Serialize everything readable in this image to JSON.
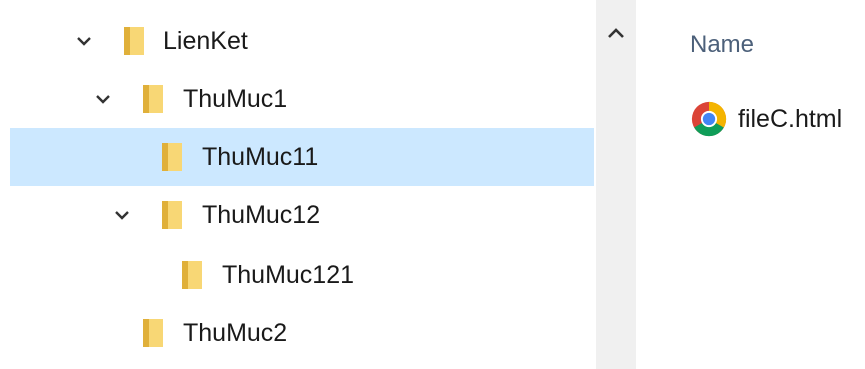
{
  "tree": {
    "items": [
      {
        "label": "LienKet",
        "expanded": true,
        "selected": false,
        "icon": "folder-icon"
      },
      {
        "label": "ThuMuc1",
        "expanded": true,
        "selected": false,
        "icon": "folder-icon"
      },
      {
        "label": "ThuMuc11",
        "expanded": false,
        "selected": true,
        "icon": "folder-icon"
      },
      {
        "label": "ThuMuc12",
        "expanded": true,
        "selected": false,
        "icon": "folder-icon"
      },
      {
        "label": "ThuMuc121",
        "expanded": false,
        "selected": false,
        "icon": "folder-icon"
      },
      {
        "label": "ThuMuc2",
        "expanded": false,
        "selected": false,
        "icon": "folder-icon"
      }
    ]
  },
  "scrollbar": {
    "up_arrow_icon": "chevron-up-icon"
  },
  "content": {
    "column_header": "Name",
    "files": [
      {
        "name": "fileC.html",
        "icon": "chrome-icon"
      }
    ]
  },
  "colors": {
    "selection": "#cce8ff",
    "folder": "#f8d775",
    "folder_shade": "#e0b03a",
    "header_text": "#4c607a",
    "scrollbar_track": "#f0f0f0"
  }
}
